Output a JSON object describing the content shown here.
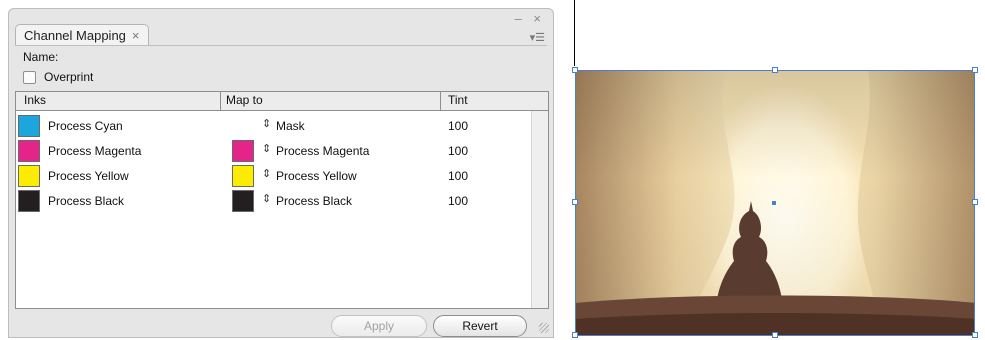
{
  "panel": {
    "title": "Channel Mapping",
    "tab_close": "×",
    "window_controls": "– ×",
    "panel_menu": "▾☰",
    "name_label": "Name:",
    "overprint_label": "Overprint",
    "overprint_checked": false
  },
  "table": {
    "headers": {
      "inks": "Inks",
      "map_to": "Map to",
      "tint": "Tint"
    },
    "rows": [
      {
        "ink": "Process Cyan",
        "ink_color": "#1ba6dd",
        "map_to": "Mask",
        "map_color": null,
        "tint": "100"
      },
      {
        "ink": "Process Magenta",
        "ink_color": "#e5248a",
        "map_to": "Process Magenta",
        "map_color": "#e5248a",
        "tint": "100"
      },
      {
        "ink": "Process Yellow",
        "ink_color": "#fdec00",
        "map_to": "Process Yellow",
        "map_color": "#fdec00",
        "tint": "100"
      },
      {
        "ink": "Process Black",
        "ink_color": "#231f20",
        "map_to": "Process Black",
        "map_color": "#231f20",
        "tint": "100"
      }
    ]
  },
  "buttons": {
    "apply": "Apply",
    "revert": "Revert",
    "apply_enabled": false
  },
  "canvas": {
    "selection_color": "#4a7fd0"
  }
}
